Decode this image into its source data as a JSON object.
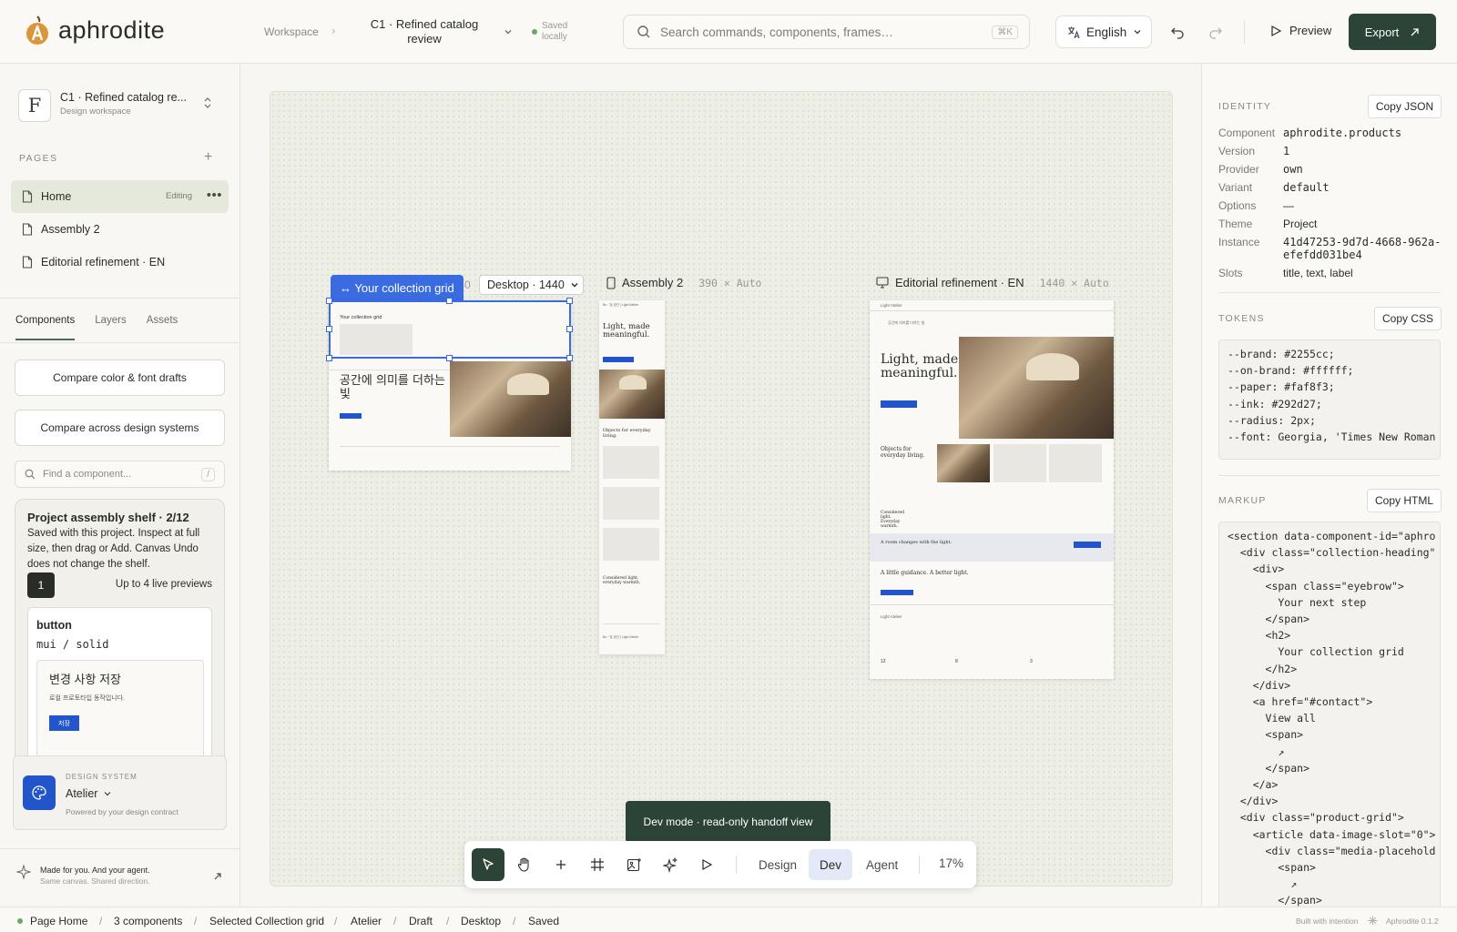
{
  "app": {
    "name": "aphrodite",
    "version": "Aphrodite 0.1.2"
  },
  "topbar": {
    "workspace": "Workspace",
    "file_title": "C1 · Refined catalog review",
    "saved": "Saved locally",
    "search_placeholder": "Search commands, components, frames…",
    "search_shortcut": "⌘K",
    "language": "English",
    "preview": "Preview",
    "export": "Export"
  },
  "sidebar": {
    "workspace_name": "C1 · Refined catalog re...",
    "workspace_sub": "Design workspace",
    "workspace_initial": "F",
    "pages_header": "PAGES",
    "pages": [
      {
        "label": "Home",
        "badge": "Editing",
        "active": true
      },
      {
        "label": "Assembly 2"
      },
      {
        "label": "Editorial refinement · EN"
      }
    ],
    "tabs": [
      "Components",
      "Layers",
      "Assets"
    ],
    "compare_buttons": [
      "Compare color & font drafts",
      "Compare across design systems"
    ],
    "find_placeholder": "Find a component...",
    "find_shortcut": "/",
    "shelf": {
      "title": "Project assembly shelf · 2/12",
      "desc": "Saved with this project. Inspect at full size, then drag or Add. Canvas Undo does not change the shelf.",
      "count": "1",
      "live": "Up to 4 live previews",
      "card": {
        "name": "button",
        "variant": "mui / solid",
        "preview_heading": "변경 사항 저장",
        "preview_text": "로컬 프로토타입 동작입니다.",
        "preview_button": "저장"
      }
    },
    "design_system": {
      "label": "DESIGN SYSTEM",
      "name": "Atelier",
      "sub": "Powered by your design contract"
    },
    "made": {
      "title": "Made for you. And your agent.",
      "sub": "Same canvas. Shared direction."
    }
  },
  "canvas": {
    "selection_label": "↔ Your collection grid",
    "breakpoint": "Desktop · 1440",
    "frames": [
      {
        "name": "Assembly 2",
        "dims": "390 × Auto"
      },
      {
        "name": "Editorial refinement · EN",
        "dims": "1440 × Auto"
      }
    ],
    "frame1": {
      "heading_ko": "공간에 의미를 더하는 빛",
      "collection": "Your collection grid"
    },
    "frame2": {
      "brand": "Bo · 및 공간 | Light Atelier",
      "heading": "Light, made meaningful.",
      "sub": "Objects for everyday living.",
      "sub2": "Considered light, everyday warmth.",
      "footer": "Bo · 및 공간 | Light Atelier"
    },
    "frame3": {
      "brand": "Light Atelier",
      "kicker": "공간에 의미를 더하는 빛",
      "heading": "Light, made meaningful.",
      "sub": "Objects for everyday living.",
      "sub2": "Considered light. Everyday warmth.",
      "band": "A room changes with the light.",
      "band2": "A little guidance. A better light.",
      "footer_brand": "Light Atelier",
      "stats": [
        "12",
        "8",
        "3"
      ]
    },
    "toast": "Dev mode · read-only handoff view",
    "modes": [
      "Design",
      "Dev",
      "Agent"
    ],
    "active_mode": "Dev",
    "zoom": "17%"
  },
  "inspector": {
    "identity_header": "IDENTITY",
    "copy_json": "Copy JSON",
    "fields": [
      {
        "k": "Component",
        "v": "aphrodite.products",
        "mono": true
      },
      {
        "k": "Version",
        "v": "1",
        "mono": true
      },
      {
        "k": "Provider",
        "v": "own",
        "mono": true
      },
      {
        "k": "Variant",
        "v": "default",
        "mono": true
      },
      {
        "k": "Options",
        "v": "—"
      },
      {
        "k": "Theme",
        "v": "Project"
      },
      {
        "k": "Instance",
        "v": "41d47253-9d7d-4668-962a-\nefefdd031be4",
        "mono": true
      },
      {
        "k": "Slots",
        "v": "title, text, label"
      }
    ],
    "tokens_header": "TOKENS",
    "copy_css": "Copy CSS",
    "tokens": "--brand: #2255cc;\n--on-brand: #ffffff;\n--paper: #faf8f3;\n--ink: #292d27;\n--radius: 2px;\n--font: Georgia, 'Times New Roman",
    "markup_header": "MARKUP",
    "copy_html": "Copy HTML",
    "markup": "<section data-component-id=\"aphro\n  <div class=\"collection-heading\"\n    <div>\n      <span class=\"eyebrow\">\n        Your next step\n      </span>\n      <h2>\n        Your collection grid\n      </h2>\n    </div>\n    <a href=\"#contact\">\n      View all\n      <span>\n        ↗\n      </span>\n    </a>\n  </div>\n  <div class=\"product-grid\">\n    <article data-image-slot=\"0\">\n      <div class=\"media-placehold\n        <span>\n          ↗\n        </span>"
  },
  "status": {
    "items": [
      "Page Home",
      "3 components",
      "Selected Collection grid",
      "Atelier",
      "Draft",
      "Desktop",
      "Saved"
    ],
    "built": "Built with intention"
  },
  "colors": {
    "accent": "#2b4437",
    "selection": "#3a6be0",
    "brand": "#2255cc",
    "saved_dot": "#6aa867"
  }
}
